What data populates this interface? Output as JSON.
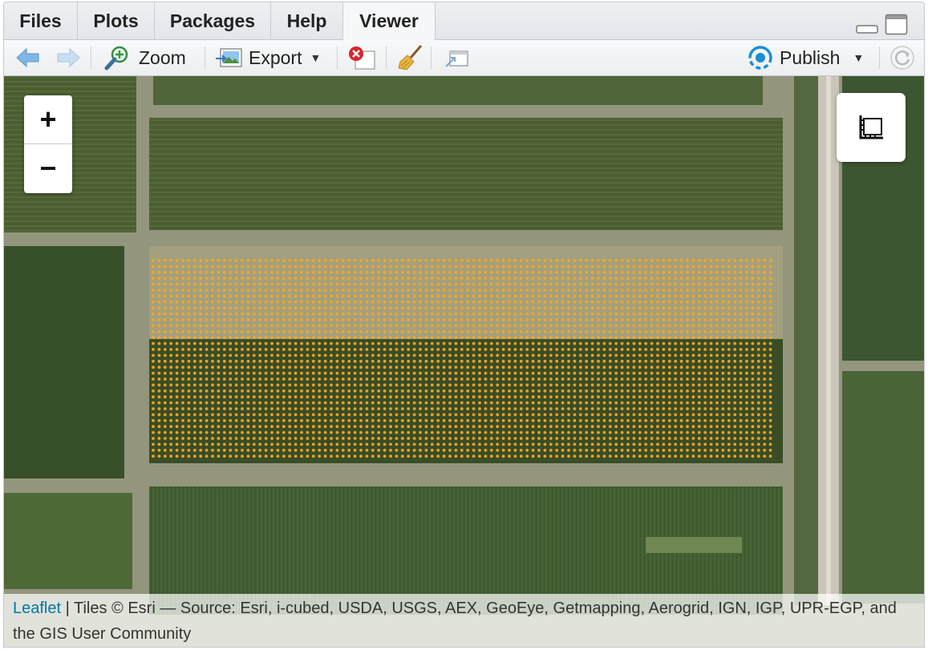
{
  "tabs": [
    {
      "label": "Files"
    },
    {
      "label": "Plots"
    },
    {
      "label": "Packages"
    },
    {
      "label": "Help"
    },
    {
      "label": "Viewer",
      "active": true
    }
  ],
  "toolbar": {
    "zoom_label": "Zoom",
    "export_label": "Export",
    "publish_label": "Publish",
    "icons": [
      "back-arrow-icon",
      "forward-arrow-icon",
      "zoom-icon",
      "export-icon",
      "clear-viewer-icon",
      "broom-icon",
      "popout-icon",
      "publish-icon",
      "refresh-icon"
    ]
  },
  "map": {
    "zoom_in_label": "+",
    "zoom_out_label": "−",
    "measure_icon": "ruler-icon",
    "point_color": "#f5a623",
    "attribution": {
      "link_text": "Leaflet",
      "text": " | Tiles © Esri — Source: Esri, i-cubed, USDA, USGS, AEX, GeoEye, Getmapping, Aerogrid, IGN, IGP, UPR-EGP, and the GIS User Community"
    }
  },
  "colors": {
    "accent": "#1a8fd6",
    "link": "#0078a8",
    "points": "#f5a623"
  }
}
